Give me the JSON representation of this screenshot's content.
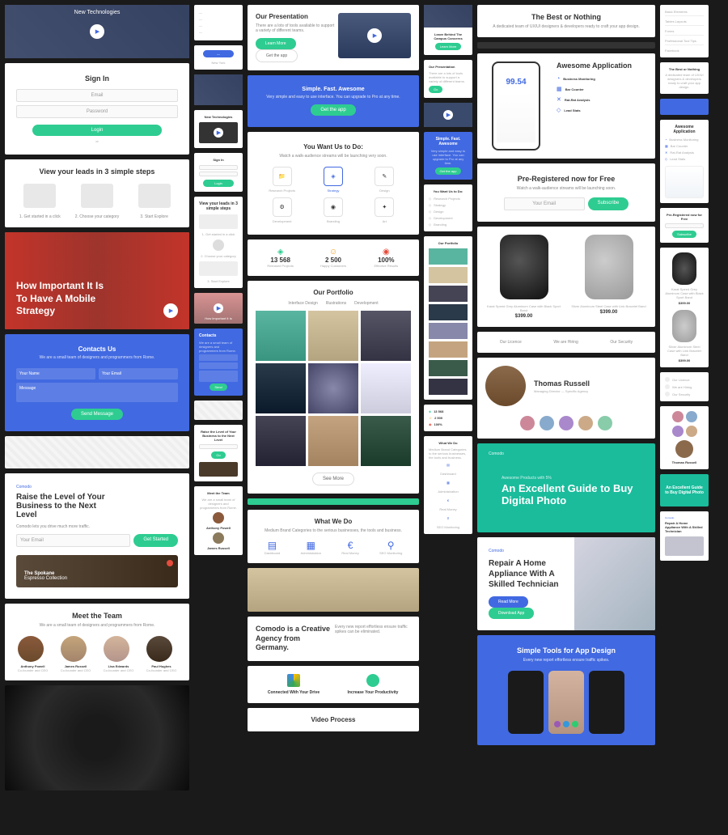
{
  "new_tech": {
    "title": "New Technologies"
  },
  "signin": {
    "title": "Sign In",
    "email": "Email",
    "password": "Password",
    "login": "Login"
  },
  "leads": {
    "title": "View your leads in 3 simple steps",
    "s1": "1. Get started in a click",
    "s2": "2. Choose your category",
    "s3": "3. Start Explore"
  },
  "mobile": {
    "line1": "How Important It Is",
    "line2": "To Have A Mobile",
    "line3": "Strategy"
  },
  "contacts": {
    "title": "Contacts Us",
    "desc": "We are a small team of designers and programmers from Rome.",
    "name": "Your Name",
    "email": "Your Email",
    "msg": "Message",
    "send": "Send Message"
  },
  "raise": {
    "title": "Raise the Level of Your Business to the Next Level",
    "desc": "Comodo lets you drive much more traffic.",
    "ph1": "Your Email",
    "btn": "Get Started"
  },
  "spokane": {
    "title": "The Spokane",
    "sub": "Espresso Collection"
  },
  "team": {
    "title": "Meet the Team",
    "desc": "We are a small team of designers and programmers from Rome.",
    "m1": "Anthony Powell",
    "m2": "James Russell",
    "m3": "Lisa Edwards",
    "m4": "Paul Hughes",
    "role": "Co-founder and CEO"
  },
  "presentation": {
    "title": "Our Presentation",
    "desc": "There are a lots of tools available to support a variety of different teams.",
    "b1": "Learn More",
    "b2": "Get the app"
  },
  "simple": {
    "title": "Simple. Fast. Awesome",
    "desc": "Very simple and easy to use interface. You can upgrade to Pro at any time.",
    "btn": "Get the app"
  },
  "want": {
    "title": "You Want Us to Do:",
    "desc": "Watch a walk-audience streams will be launching very soon.",
    "i1": "Research Projects",
    "i2": "Strategy",
    "i3": "Design",
    "i4": "Development",
    "i5": "Branding",
    "i6": "Art"
  },
  "stats": {
    "v1": "13 568",
    "l1": "Released Projects",
    "v2": "2 500",
    "l2": "Happy Customers",
    "v3": "100%",
    "l3": "Effective Results"
  },
  "portfolio": {
    "title": "Our Portfolio",
    "tab1": "Interface Design",
    "tab2": "Illustrations",
    "tab3": "Development",
    "btn": "See More"
  },
  "whatwedo": {
    "title": "What We Do",
    "desc": "Medium Brand Categories to the serious businesses, the tools and business.",
    "i1": "Dashboard",
    "i2": "Administration",
    "i3": "Real Money",
    "i4": "SEO Monitoring"
  },
  "comodo": {
    "title": "Comodo is a Creative Agency from Germany.",
    "desc": "Every new report effortless ensure traffic spikes can be eliminated."
  },
  "drive": {
    "t1": "Connected With Your Drive",
    "t2": "Increase Your Productivity"
  },
  "video": {
    "title": "Video Process"
  },
  "best": {
    "title": "The Best or Nothing",
    "desc": "A dedicated team of UX/UI designers & developers ready to craft your app design."
  },
  "awesome": {
    "title": "Awesome Application",
    "f1": "Business Monitoring",
    "f2": "Bar Counter",
    "f3": "Rat-Rat Analysis",
    "f4": "Lead Stats",
    "big": "99.54"
  },
  "prereg": {
    "title": "Pre-Registered now for Free",
    "desc": "Watch a walk-audience streams will be launching soon.",
    "ph": "Your Email",
    "btn": "Subscribe"
  },
  "product": {
    "p1": "Karat Speed Grey Aluminum Case with Black Sport Band",
    "p2": "Silver Aluminum Steel Case with Link Bracelet Band",
    "price": "$399.00"
  },
  "russell": {
    "name": "Thomas Russell",
    "role": "Managing Director — Specific Agency"
  },
  "guide": {
    "pre": "Awesome Products with 5%",
    "title": "An Excellent Guide to Buy Digital Photo"
  },
  "repair": {
    "title": "Repair A Home Appliance With A Skilled Technician",
    "b1": "Read More",
    "b2": "Download App"
  },
  "tools": {
    "title": "Simple Tools for App Design",
    "desc": "Every new report effortless ensure traffic spikes."
  },
  "pricing": {
    "i1": "Our Licence",
    "i2": "We are Hiring",
    "i3": "Our Security"
  },
  "campus": {
    "title": "Leave Behind The Campus Concerns",
    "btn": "Learn More"
  },
  "nav": {
    "i1": "Basic Elements",
    "i2": "Tables Layouts",
    "i3": "Forms",
    "i4": "Professional Tool Tips",
    "i5": "Facebook"
  }
}
